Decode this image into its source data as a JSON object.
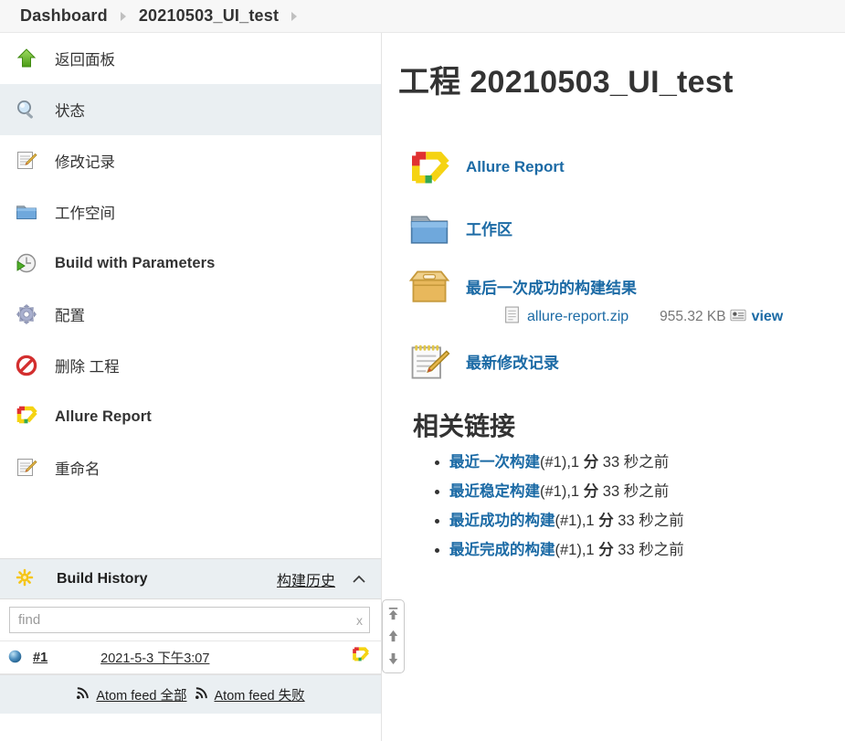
{
  "breadcrumb": {
    "items": [
      "Dashboard",
      "20210503_UI_test"
    ]
  },
  "sidebar": {
    "tasks": [
      {
        "label": "返回面板",
        "icon": "up-arrow-green-icon",
        "latin": false,
        "active": false
      },
      {
        "label": "状态",
        "icon": "magnifier-icon",
        "latin": false,
        "active": true
      },
      {
        "label": "修改记录",
        "icon": "notepad-pencil-icon",
        "latin": false,
        "active": false
      },
      {
        "label": "工作空间",
        "icon": "folder-blue-icon",
        "latin": false,
        "active": false
      },
      {
        "label": "Build with Parameters",
        "icon": "build-clock-icon",
        "latin": true,
        "active": false
      },
      {
        "label": "配置",
        "icon": "gear-icon",
        "latin": false,
        "active": false
      },
      {
        "label": "删除 工程",
        "icon": "delete-forbidden-icon",
        "latin": false,
        "active": false
      },
      {
        "label": "Allure Report",
        "icon": "allure-logo-icon",
        "latin": true,
        "active": false
      },
      {
        "label": "重命名",
        "icon": "notepad-pencil-icon",
        "latin": false,
        "active": false
      }
    ],
    "build_history": {
      "title": "Build History",
      "link_label": "构建历史",
      "find_placeholder": "find",
      "find_value": "",
      "clear_label": "x",
      "rows": [
        {
          "status": "blue-ball",
          "number": "#1",
          "date": "2021-5-3 下午3:07",
          "report_icon": "allure-logo-icon"
        }
      ],
      "feeds": [
        {
          "label": "Atom feed 全部"
        },
        {
          "label": "Atom feed 失败"
        }
      ]
    }
  },
  "main": {
    "title": "工程 20210503_UI_test",
    "actions": [
      {
        "label": "Allure Report",
        "icon": "allure-logo-icon"
      },
      {
        "label": "工作区",
        "icon": "folder-blue-icon"
      },
      {
        "label": "最后一次成功的构建结果",
        "icon": "package-box-icon",
        "artifact": {
          "name": "allure-report.zip",
          "size": "955.32 KB",
          "view_label": "view",
          "file_icon": "document-icon",
          "view_icon": "view-window-icon"
        }
      },
      {
        "label": "最新修改记录",
        "icon": "notepad-pencil-icon"
      }
    ],
    "related": {
      "heading": "相关链接",
      "items": [
        {
          "link": "最近一次构建",
          "suffix_pre": "(#1),1 ",
          "suffix_bold": "分",
          "suffix_post": " 33 秒之前"
        },
        {
          "link": "最近稳定构建",
          "suffix_pre": "(#1),1 ",
          "suffix_bold": "分",
          "suffix_post": " 33 秒之前"
        },
        {
          "link": "最近成功的构建",
          "suffix_pre": "(#1),1 ",
          "suffix_bold": "分",
          "suffix_post": " 33 秒之前"
        },
        {
          "link": "最近完成的构建",
          "suffix_pre": "(#1),1 ",
          "suffix_bold": "分",
          "suffix_post": " 33 秒之前"
        }
      ]
    }
  },
  "scroller": {
    "buttons": [
      "scroll-to-top-icon",
      "scroll-up-icon",
      "scroll-down-icon"
    ]
  },
  "colors": {
    "link": "#1b6aa5",
    "highlight_bg": "#eaeff2",
    "breadcrumb_bg": "#f7f7f7"
  }
}
